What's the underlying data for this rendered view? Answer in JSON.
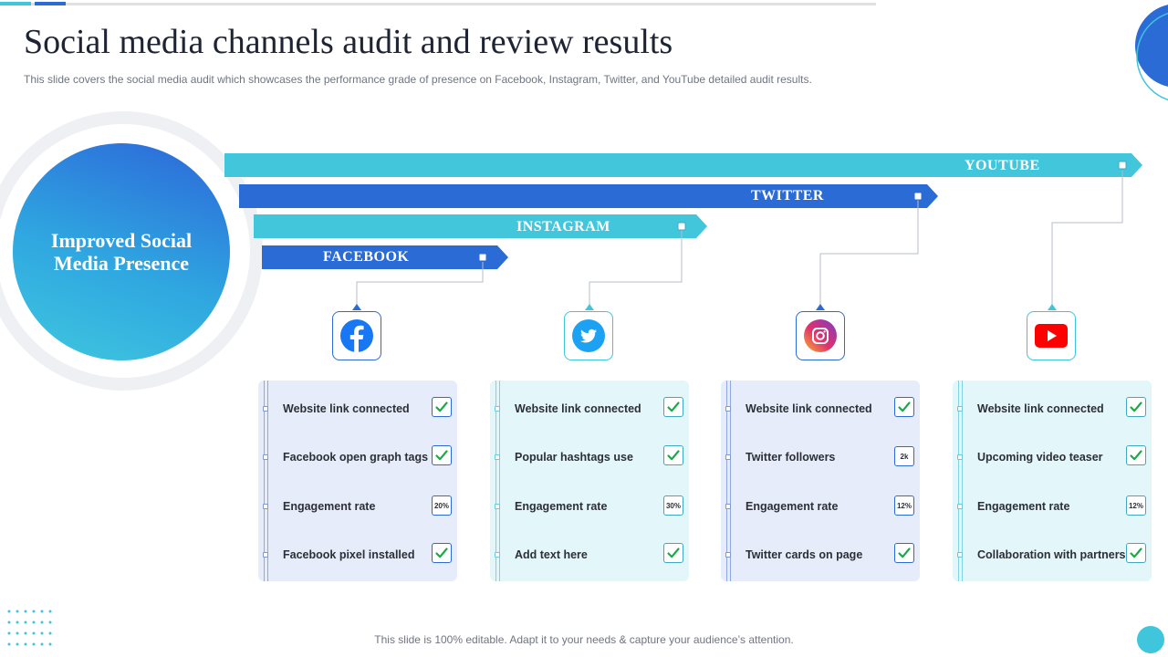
{
  "header": {
    "title": "Social media channels audit and review results",
    "subtitle": "This slide covers the social media audit which showcases the performance grade of presence on Facebook, Instagram, Twitter, and YouTube detailed audit results."
  },
  "hub": {
    "text": "Improved Social Media Presence"
  },
  "channels": {
    "youtube": "YOUTUBE",
    "twitter": "TWITTER",
    "instagram": "INSTAGRAM",
    "facebook": "FACEBOOK"
  },
  "icons": [
    "facebook-icon",
    "twitter-icon",
    "instagram-icon",
    "youtube-icon"
  ],
  "panels": [
    {
      "rows": [
        {
          "label": "Website link connected",
          "status": "check"
        },
        {
          "label": "Facebook open graph tags",
          "status": "check"
        },
        {
          "label": "Engagement rate",
          "value": "20%"
        },
        {
          "label": "Facebook pixel installed",
          "status": "check"
        }
      ]
    },
    {
      "rows": [
        {
          "label": "Website link connected",
          "status": "check"
        },
        {
          "label": "Popular hashtags use",
          "status": "check"
        },
        {
          "label": "Engagement rate",
          "value": "30%"
        },
        {
          "label": "Add text here",
          "status": "check"
        }
      ]
    },
    {
      "rows": [
        {
          "label": "Website link connected",
          "status": "check"
        },
        {
          "label": "Twitter followers",
          "value": "2k"
        },
        {
          "label": "Engagement rate",
          "value": "12%"
        },
        {
          "label": "Twitter cards on page",
          "status": "check"
        }
      ]
    },
    {
      "rows": [
        {
          "label": "Website link connected",
          "status": "check"
        },
        {
          "label": "Upcoming video teaser",
          "status": "check"
        },
        {
          "label": "Engagement rate",
          "value": "12%"
        },
        {
          "label": "Collaboration  with partners",
          "status": "check"
        }
      ]
    }
  ],
  "footer": {
    "text": "This slide is 100% editable. Adapt it to your needs & capture your audience’s attention."
  },
  "colors": {
    "blue": "#2b6bd6",
    "cyan": "#3fc5dc",
    "check_green": "#1fa84a",
    "title": "#1e2433"
  }
}
